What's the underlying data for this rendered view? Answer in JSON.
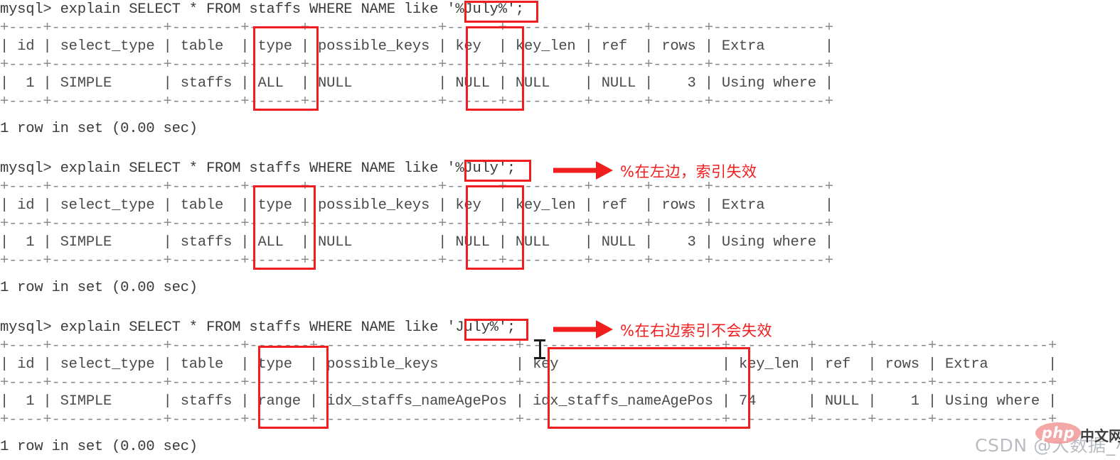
{
  "terminal": {
    "blocks": [
      {
        "id": "block1",
        "prompt_line": "mysql> explain SELECT * FROM staffs WHERE NAME like '%July%';",
        "quoted_literal": "'%July%'",
        "rule_top": "+----+-------------+--------+------+---------------+------+---------+------+------+-------------+",
        "header": "| id | select_type | table  | type | possible_keys | key  | key_len | ref  | rows | Extra       |",
        "rule_mid": "+----+-------------+--------+------+---------------+------+---------+------+------+-------------+",
        "row": "|  1 | SIMPLE      | staffs | ALL  | NULL          | NULL | NULL    | NULL |    3 | Using where |",
        "rule_bot": "+----+-------------+--------+------+---------------+------+---------+------+------+-------------+",
        "footer": "1 row in set (0.00 sec)",
        "columns": [
          "id",
          "select_type",
          "table",
          "type",
          "possible_keys",
          "key",
          "key_len",
          "ref",
          "rows",
          "Extra"
        ],
        "values": [
          "1",
          "SIMPLE",
          "staffs",
          "ALL",
          "NULL",
          "NULL",
          "NULL",
          "NULL",
          "3",
          "Using where"
        ],
        "annotation": ""
      },
      {
        "id": "block2",
        "prompt_line": "mysql> explain SELECT * FROM staffs WHERE NAME like '%July';",
        "quoted_literal": "'%July'",
        "rule_top": "+----+-------------+--------+------+---------------+------+---------+------+------+-------------+",
        "header": "| id | select_type | table  | type | possible_keys | key  | key_len | ref  | rows | Extra       |",
        "rule_mid": "+----+-------------+--------+------+---------------+------+---------+------+------+-------------+",
        "row": "|  1 | SIMPLE      | staffs | ALL  | NULL          | NULL | NULL    | NULL |    3 | Using where |",
        "rule_bot": "+----+-------------+--------+------+---------------+------+---------+------+------+-------------+",
        "footer": "1 row in set (0.00 sec)",
        "columns": [
          "id",
          "select_type",
          "table",
          "type",
          "possible_keys",
          "key",
          "key_len",
          "ref",
          "rows",
          "Extra"
        ],
        "values": [
          "1",
          "SIMPLE",
          "staffs",
          "ALL",
          "NULL",
          "NULL",
          "NULL",
          "NULL",
          "3",
          "Using where"
        ],
        "annotation": "%在左边，索引失效"
      },
      {
        "id": "block3",
        "prompt_line": "mysql> explain SELECT * FROM staffs WHERE NAME like 'July%';",
        "quoted_literal": "'July%'",
        "rule_top": "+----+-------------+--------+-------+-----------------------+-----------------------+---------+------+------+-------------+",
        "header": "| id | select_type | table  | type  | possible_keys         | key                   | key_len | ref  | rows | Extra       |",
        "rule_mid": "+----+-------------+--------+-------+-----------------------+-----------------------+---------+------+------+-------------+",
        "row": "|  1 | SIMPLE      | staffs | range | idx_staffs_nameAgePos | idx_staffs_nameAgePos | 74      | NULL |    1 | Using where |",
        "rule_bot": "+----+-------------+--------+-------+-----------------------+-----------------------+---------+------+------+-------------+",
        "footer": "1 row in set (0.00 sec)",
        "columns": [
          "id",
          "select_type",
          "table",
          "type",
          "possible_keys",
          "key",
          "key_len",
          "ref",
          "rows",
          "Extra"
        ],
        "values": [
          "1",
          "SIMPLE",
          "staffs",
          "range",
          "idx_staffs_nameAgePos",
          "idx_staffs_nameAgePos",
          "74",
          "NULL",
          "1",
          "Using where"
        ],
        "annotation": "%在右边索引不会失效"
      }
    ]
  },
  "annotations": {
    "highlight_color": "#f01e1e",
    "boxes": [
      {
        "name": "literal-box-1",
        "label": "'%July%'"
      },
      {
        "name": "type-column-box-1",
        "label": "type / ALL"
      },
      {
        "name": "key-column-box-1",
        "label": "key / NULL"
      },
      {
        "name": "literal-box-2",
        "label": "'%July'"
      },
      {
        "name": "type-column-box-2",
        "label": "type / ALL"
      },
      {
        "name": "key-column-box-2",
        "label": "key / NULL"
      },
      {
        "name": "literal-box-3",
        "label": "'July%'"
      },
      {
        "name": "type-column-box-3",
        "label": "type / range"
      },
      {
        "name": "key-column-box-3",
        "label": "key / idx_staffs_nameAgePos"
      }
    ],
    "note_left": "%在左边，索引失效",
    "note_right": "%在右边索引不会失效"
  },
  "watermark": {
    "csdn": "CSDN @大数据_小衰",
    "php_logo": "php",
    "php_cn": "中文网"
  }
}
